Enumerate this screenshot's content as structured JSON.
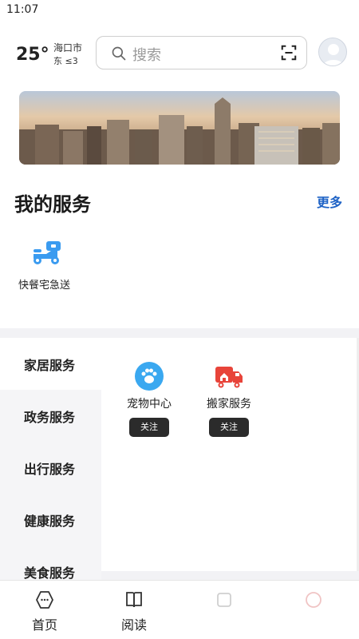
{
  "status_bar": {
    "time": "11:07"
  },
  "header": {
    "temperature": "25°",
    "city": "海口市",
    "wind": "东 ≤3",
    "search_placeholder": "搜索",
    "search_icon": "search-icon",
    "scan_icon": "scan-icon",
    "avatar_icon": "avatar"
  },
  "banner": {
    "image": "city-skyline"
  },
  "my_services": {
    "title": "我的服务",
    "more_label": "更多",
    "items": [
      {
        "label": "快餐宅急送",
        "icon": "scooter-icon",
        "color": "#3a9bf0"
      }
    ]
  },
  "categories": {
    "items": [
      {
        "label": "家居服务",
        "active": true
      },
      {
        "label": "政务服务"
      },
      {
        "label": "出行服务"
      },
      {
        "label": "健康服务"
      },
      {
        "label": "美食服务"
      }
    ]
  },
  "category_tiles": [
    {
      "label": "宠物中心",
      "icon": "paw-icon",
      "color": "#3aa8f0",
      "button": "关注"
    },
    {
      "label": "搬家服务",
      "icon": "truck-icon",
      "color": "#e8443a",
      "button": "关注"
    }
  ],
  "tabbar": {
    "items": [
      {
        "label": "首页",
        "icon": "home-icon"
      },
      {
        "label": "阅读",
        "icon": "book-icon"
      },
      {
        "label": "",
        "icon": "activity-icon"
      },
      {
        "label": "",
        "icon": "profile-icon"
      },
      {
        "label": "",
        "icon": "more-icon"
      }
    ]
  },
  "colors": {
    "accent": "#1f63c6",
    "button_bg": "#2b2b2b",
    "divider": "#f2f2f5"
  }
}
